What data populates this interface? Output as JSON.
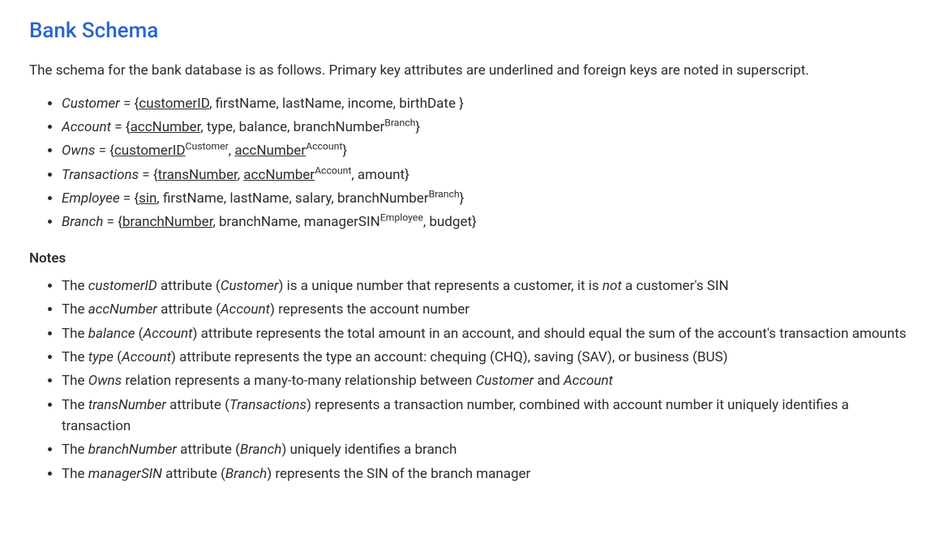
{
  "title": "Bank Schema",
  "intro": "The schema for the bank database is as follows. Primary key attributes are underlined and foreign keys are noted in superscript.",
  "schema": [
    {
      "relation": "Customer",
      "attributes": [
        {
          "name": "customerID",
          "pk": true,
          "fk": null
        },
        {
          "name": "firstName",
          "pk": false,
          "fk": null
        },
        {
          "name": "lastName",
          "pk": false,
          "fk": null
        },
        {
          "name": "income",
          "pk": false,
          "fk": null
        },
        {
          "name": "birthDate",
          "pk": false,
          "fk": null
        }
      ]
    },
    {
      "relation": "Account",
      "attributes": [
        {
          "name": "accNumber",
          "pk": true,
          "fk": null
        },
        {
          "name": "type",
          "pk": false,
          "fk": null
        },
        {
          "name": "balance",
          "pk": false,
          "fk": null
        },
        {
          "name": "branchNumber",
          "pk": false,
          "fk": "Branch"
        }
      ]
    },
    {
      "relation": "Owns",
      "attributes": [
        {
          "name": "customerID",
          "pk": true,
          "fk": "Customer"
        },
        {
          "name": "accNumber",
          "pk": true,
          "fk": "Account"
        }
      ]
    },
    {
      "relation": "Transactions",
      "attributes": [
        {
          "name": "transNumber",
          "pk": true,
          "fk": null
        },
        {
          "name": "accNumber",
          "pk": true,
          "fk": "Account"
        },
        {
          "name": "amount",
          "pk": false,
          "fk": null
        }
      ]
    },
    {
      "relation": "Employee",
      "attributes": [
        {
          "name": "sin",
          "pk": true,
          "fk": null
        },
        {
          "name": "firstName",
          "pk": false,
          "fk": null
        },
        {
          "name": "lastName",
          "pk": false,
          "fk": null
        },
        {
          "name": "salary",
          "pk": false,
          "fk": null
        },
        {
          "name": "branchNumber",
          "pk": false,
          "fk": "Branch"
        }
      ]
    },
    {
      "relation": "Branch",
      "attributes": [
        {
          "name": "branchNumber",
          "pk": true,
          "fk": null
        },
        {
          "name": "branchName",
          "pk": false,
          "fk": null
        },
        {
          "name": "managerSIN",
          "pk": false,
          "fk": "Employee"
        },
        {
          "name": "budget",
          "pk": false,
          "fk": null
        }
      ]
    }
  ],
  "notes_header": "Notes",
  "notes": [
    {
      "parts": [
        {
          "t": "The ",
          "s": "plain"
        },
        {
          "t": "customerID",
          "s": "ital"
        },
        {
          "t": " attribute (",
          "s": "plain"
        },
        {
          "t": "Customer",
          "s": "ital"
        },
        {
          "t": ") is a unique number that represents a customer, it is ",
          "s": "plain"
        },
        {
          "t": "not",
          "s": "ital"
        },
        {
          "t": " a customer's SIN",
          "s": "plain"
        }
      ]
    },
    {
      "parts": [
        {
          "t": "The ",
          "s": "plain"
        },
        {
          "t": "accNumber",
          "s": "ital"
        },
        {
          "t": " attribute (",
          "s": "plain"
        },
        {
          "t": "Account",
          "s": "ital"
        },
        {
          "t": ") represents the account number",
          "s": "plain"
        }
      ]
    },
    {
      "parts": [
        {
          "t": "The ",
          "s": "plain"
        },
        {
          "t": "balance",
          "s": "ital"
        },
        {
          "t": " (",
          "s": "plain"
        },
        {
          "t": "Account",
          "s": "ital"
        },
        {
          "t": ") attribute represents the total amount in an account, and should equal the sum of the account's transaction amounts",
          "s": "plain"
        }
      ]
    },
    {
      "parts": [
        {
          "t": "The ",
          "s": "plain"
        },
        {
          "t": "type",
          "s": "ital"
        },
        {
          "t": " (",
          "s": "plain"
        },
        {
          "t": "Account",
          "s": "ital"
        },
        {
          "t": ") attribute represents the type an account: chequing (CHQ), saving (SAV), or business (BUS)",
          "s": "plain"
        }
      ]
    },
    {
      "parts": [
        {
          "t": "The ",
          "s": "plain"
        },
        {
          "t": "Owns",
          "s": "ital"
        },
        {
          "t": " relation represents a many-to-many relationship between ",
          "s": "plain"
        },
        {
          "t": "Customer",
          "s": "ital"
        },
        {
          "t": " and ",
          "s": "plain"
        },
        {
          "t": "Account",
          "s": "ital"
        }
      ]
    },
    {
      "parts": [
        {
          "t": "The ",
          "s": "plain"
        },
        {
          "t": "transNumber",
          "s": "ital"
        },
        {
          "t": " attribute (",
          "s": "plain"
        },
        {
          "t": "Transactions",
          "s": "ital"
        },
        {
          "t": ") represents a transaction number, combined with account number it uniquely identifies a transaction",
          "s": "plain"
        }
      ]
    },
    {
      "parts": [
        {
          "t": "The ",
          "s": "plain"
        },
        {
          "t": "branchNumber",
          "s": "ital"
        },
        {
          "t": " attribute (",
          "s": "plain"
        },
        {
          "t": "Branch",
          "s": "ital"
        },
        {
          "t": ") uniquely identifies a branch",
          "s": "plain"
        }
      ]
    },
    {
      "parts": [
        {
          "t": "The ",
          "s": "plain"
        },
        {
          "t": "managerSIN",
          "s": "ital"
        },
        {
          "t": " attribute (",
          "s": "plain"
        },
        {
          "t": "Branch",
          "s": "ital"
        },
        {
          "t": ") represents the SIN of the branch manager",
          "s": "plain"
        }
      ]
    }
  ]
}
